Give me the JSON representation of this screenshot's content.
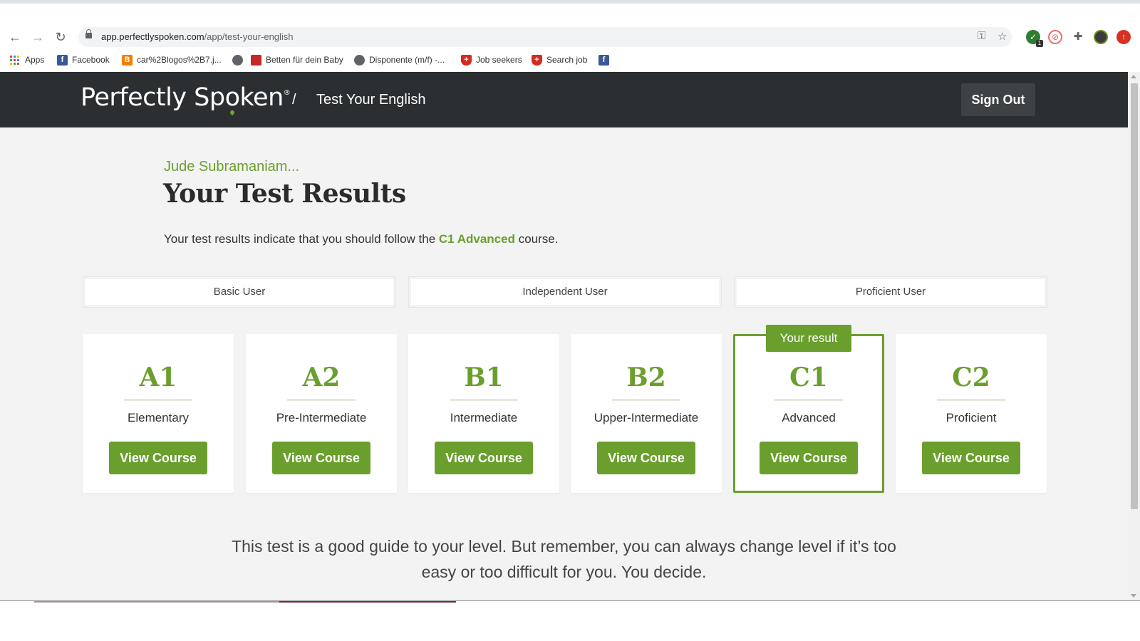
{
  "browser": {
    "url_host": "app.perfectlyspoken.com",
    "url_path": "/app/test-your-english",
    "bookmarks": [
      {
        "label": "Apps"
      },
      {
        "label": "Facebook"
      },
      {
        "label": "car%2Blogos%2B7.j..."
      },
      {
        "label": ""
      },
      {
        "label": "Betten für dein Baby"
      },
      {
        "label": "Disponente (m/f) -..."
      },
      {
        "label": "Job seekers"
      },
      {
        "label": "Search job"
      },
      {
        "label": ""
      }
    ],
    "extension_badge": "1"
  },
  "header": {
    "logo_text_1": "Perfectly Sp",
    "logo_text_o": "o",
    "logo_text_2": "ken",
    "logo_reg": "®",
    "separator": "/",
    "crumb": "Test Your English",
    "sign_out": "Sign Out"
  },
  "results": {
    "user_name": "Jude Subramaniam...",
    "title": "Your Test Results",
    "intro_before": "Your test results indicate that you should follow the ",
    "intro_course": "C1 Advanced",
    "intro_after": " course.",
    "groups": [
      "Basic User",
      "Independent User",
      "Proficient User"
    ],
    "badge": "Your result",
    "levels": [
      {
        "code": "A1",
        "name": "Elementary",
        "button": "View Course"
      },
      {
        "code": "A2",
        "name": "Pre-Intermediate",
        "button": "View Course"
      },
      {
        "code": "B1",
        "name": "Intermediate",
        "button": "View Course"
      },
      {
        "code": "B2",
        "name": "Upper-Intermediate",
        "button": "View Course"
      },
      {
        "code": "C1",
        "name": "Advanced",
        "button": "View Course"
      },
      {
        "code": "C2",
        "name": "Proficient",
        "button": "View Course"
      }
    ],
    "active_level": "C1",
    "footnote": "This test is a good guide to your level. But remember, you can always change level if it’s too easy or too difficult for you. You decide."
  },
  "colors": {
    "accent": "#6a9f2e",
    "header_bg": "#2c2f31",
    "page_bg": "#f2f3f2"
  }
}
